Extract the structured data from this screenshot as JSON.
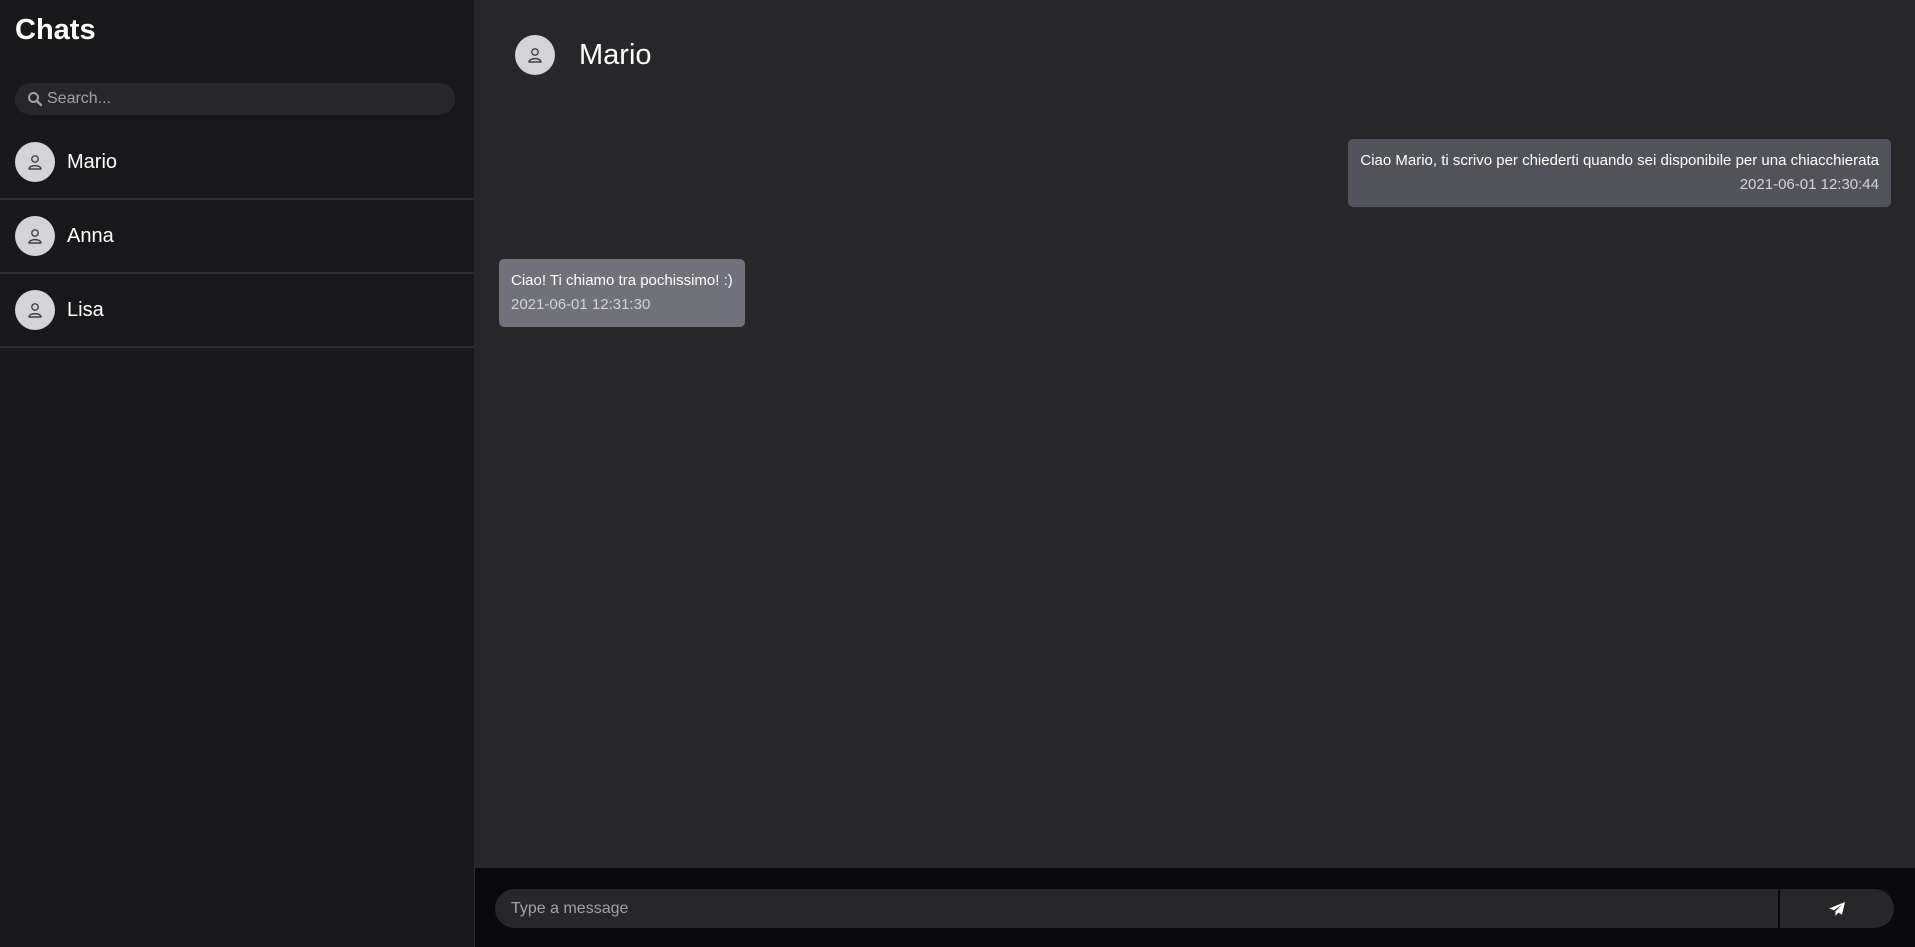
{
  "sidebar": {
    "title": "Chats",
    "search": {
      "placeholder": "Search...",
      "value": ""
    },
    "items": [
      {
        "name": "Mario",
        "icon": "user-icon"
      },
      {
        "name": "Anna",
        "icon": "user-icon"
      },
      {
        "name": "Lisa",
        "icon": "user-icon"
      }
    ]
  },
  "header": {
    "name": "Mario",
    "icon": "user-icon"
  },
  "messages": [
    {
      "direction": "sent",
      "text": "Ciao Mario, ti scrivo per chiederti quando sei disponibile per una chiacchierata",
      "time": "2021-06-01 12:30:44"
    },
    {
      "direction": "received",
      "text": "Ciao! Ti chiamo tra pochissimo! :)",
      "time": "2021-06-01 12:31:30"
    }
  ],
  "composer": {
    "placeholder": "Type a message",
    "value": "",
    "send_icon": "paper-plane-icon"
  },
  "colors": {
    "sidebar_bg": "#18181b",
    "main_bg": "#27272a",
    "sent_bubble": "#52525b",
    "received_bubble": "#71717a",
    "composer_bg": "#09090b"
  }
}
